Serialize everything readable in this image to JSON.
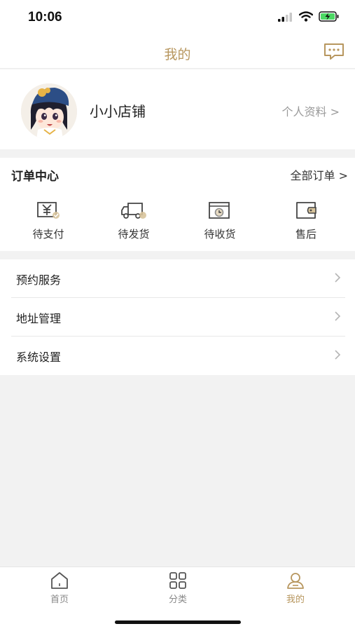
{
  "status_bar": {
    "time": "10:06"
  },
  "nav": {
    "title": "我的",
    "message_icon": "message-icon"
  },
  "profile": {
    "name": "小小店铺",
    "link_label": "个人资料 >"
  },
  "orders": {
    "title": "订单中心",
    "all_label": "全部订单 >",
    "items": [
      {
        "label": "待支付",
        "icon": "payment-icon"
      },
      {
        "label": "待发货",
        "icon": "truck-icon"
      },
      {
        "label": "待收货",
        "icon": "receive-box-icon"
      },
      {
        "label": "售后",
        "icon": "wallet-icon"
      }
    ]
  },
  "menu": {
    "items": [
      {
        "label": "预约服务"
      },
      {
        "label": "地址管理"
      },
      {
        "label": "系统设置"
      }
    ]
  },
  "tabs": [
    {
      "label": "首页",
      "icon": "home-icon"
    },
    {
      "label": "分类",
      "icon": "category-icon"
    },
    {
      "label": "我的",
      "icon": "user-icon"
    }
  ],
  "colors": {
    "accent": "#b7965e",
    "background": "#f2f2f2",
    "text": "#222222",
    "muted": "#9a9a9a"
  }
}
